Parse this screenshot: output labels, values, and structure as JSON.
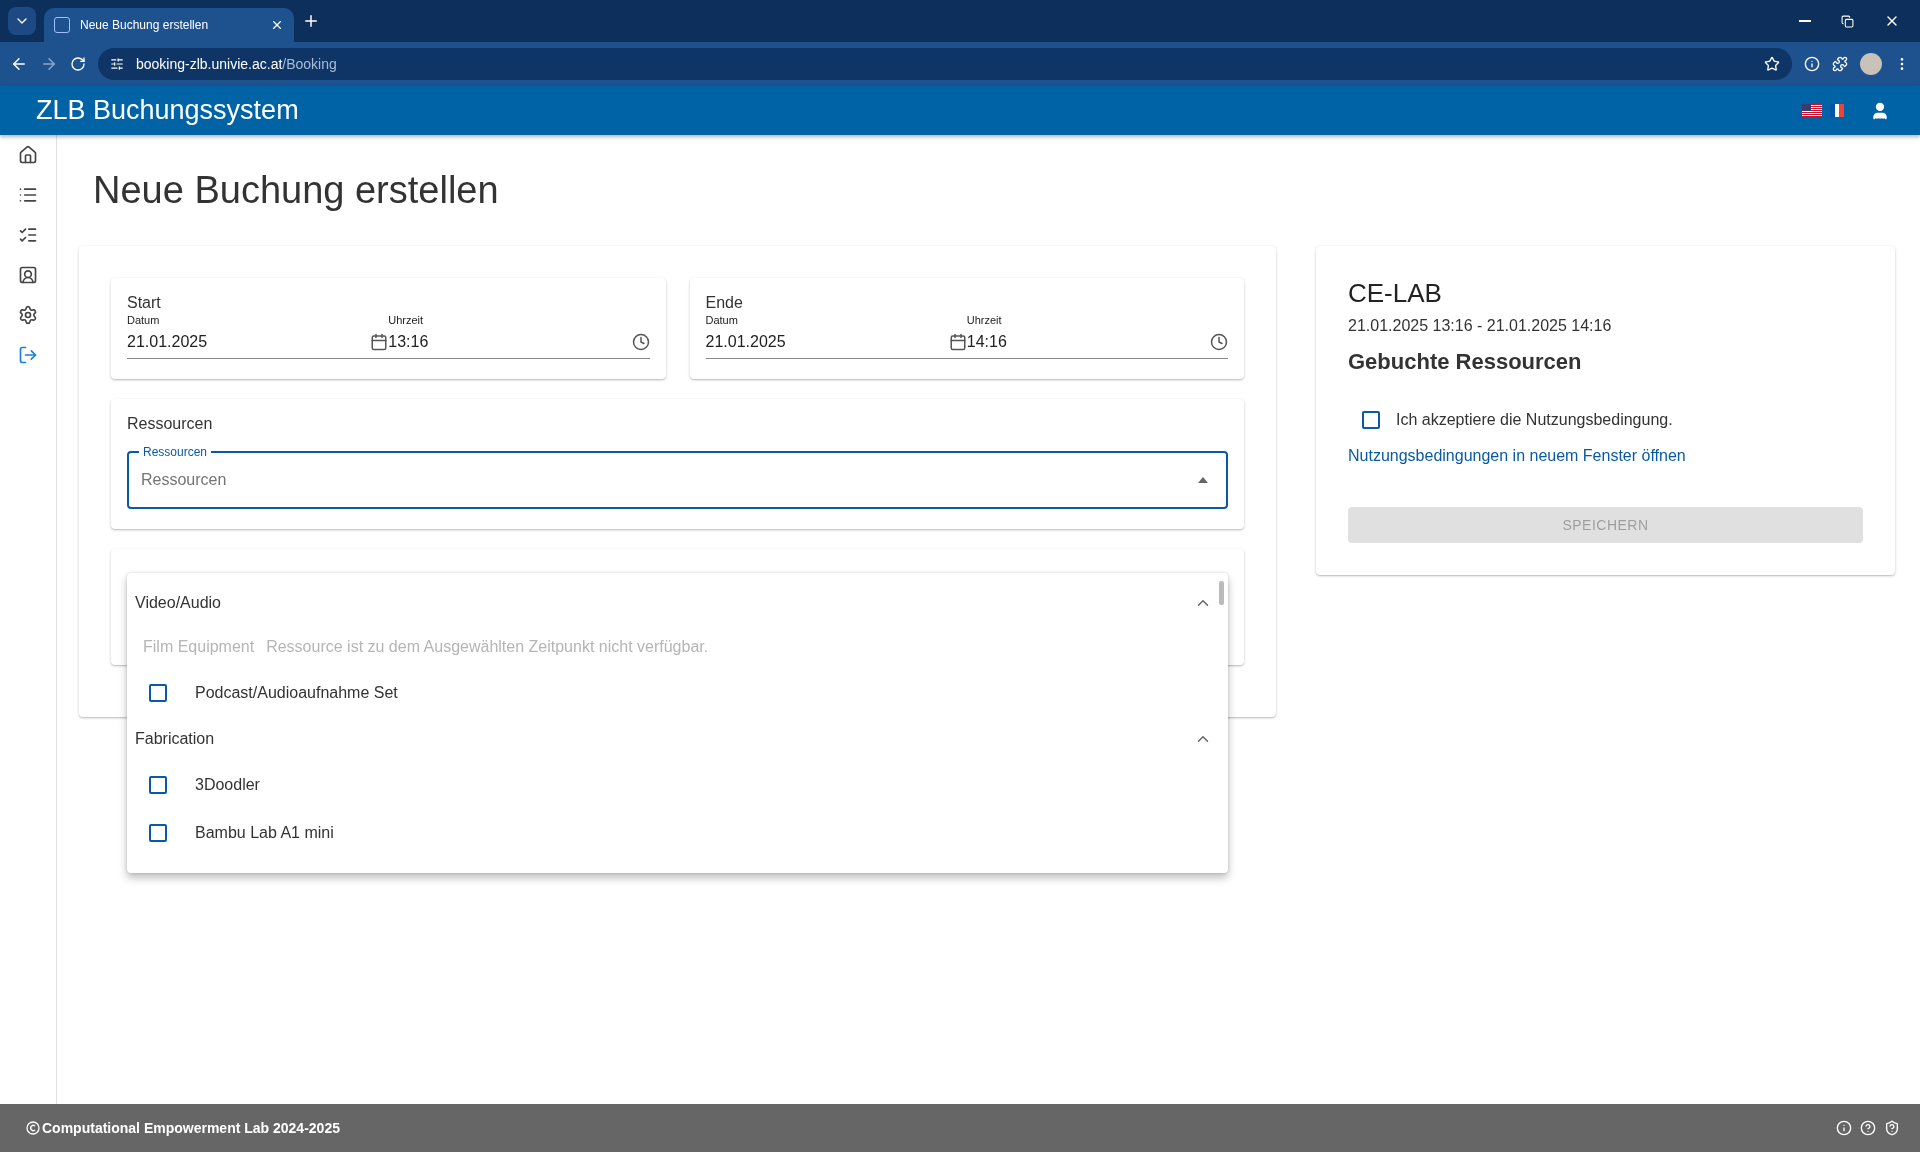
{
  "browser": {
    "tab_title": "Neue Buchung erstellen",
    "url_host": "booking-zlb.univie.ac.at",
    "url_path": "/Booking"
  },
  "app": {
    "title": "ZLB Buchungssystem"
  },
  "page_title": "Neue Buchung erstellen",
  "periods": [
    {
      "heading": "Start",
      "date_label": "Datum",
      "date": "21.01.2025",
      "time_label": "Uhrzeit",
      "time": "13:16"
    },
    {
      "heading": "Ende",
      "date_label": "Datum",
      "date": "21.01.2025",
      "time_label": "Uhrzeit",
      "time": "14:16"
    }
  ],
  "resources": {
    "heading": "Ressourcen",
    "field_label": "Ressourcen",
    "placeholder": "Ressourcen",
    "expanded": true
  },
  "dropdown": {
    "groups": [
      {
        "name": "Video/Audio",
        "expanded": true,
        "items": [
          {
            "kind": "unavailable",
            "name": "Film Equipment",
            "note": "Ressource ist zu dem Ausgewählten Zeitpunkt nicht verfügbar."
          },
          {
            "kind": "option",
            "name": "Podcast/Audioaufnahme Set",
            "checked": false
          }
        ]
      },
      {
        "name": "Fabrication",
        "expanded": true,
        "items": [
          {
            "kind": "option",
            "name": "3Doodler",
            "checked": false
          },
          {
            "kind": "option",
            "name": "Bambu Lab A1 mini",
            "checked": false
          }
        ]
      }
    ]
  },
  "summary": {
    "title": "CE-LAB",
    "range": "21.01.2025 13:16 - 21.01.2025 14:16",
    "heading": "Gebuchte Ressourcen",
    "accept": {
      "label": "Ich akzeptiere die Nutzungsbedingung.",
      "checked": false
    },
    "link": "Nutzungsbedingungen in neuem Fenster öffnen",
    "save": {
      "label": "SPEICHERN",
      "disabled": true
    }
  },
  "footer": {
    "text": "Computational Empowerment Lab 2024-2025"
  }
}
